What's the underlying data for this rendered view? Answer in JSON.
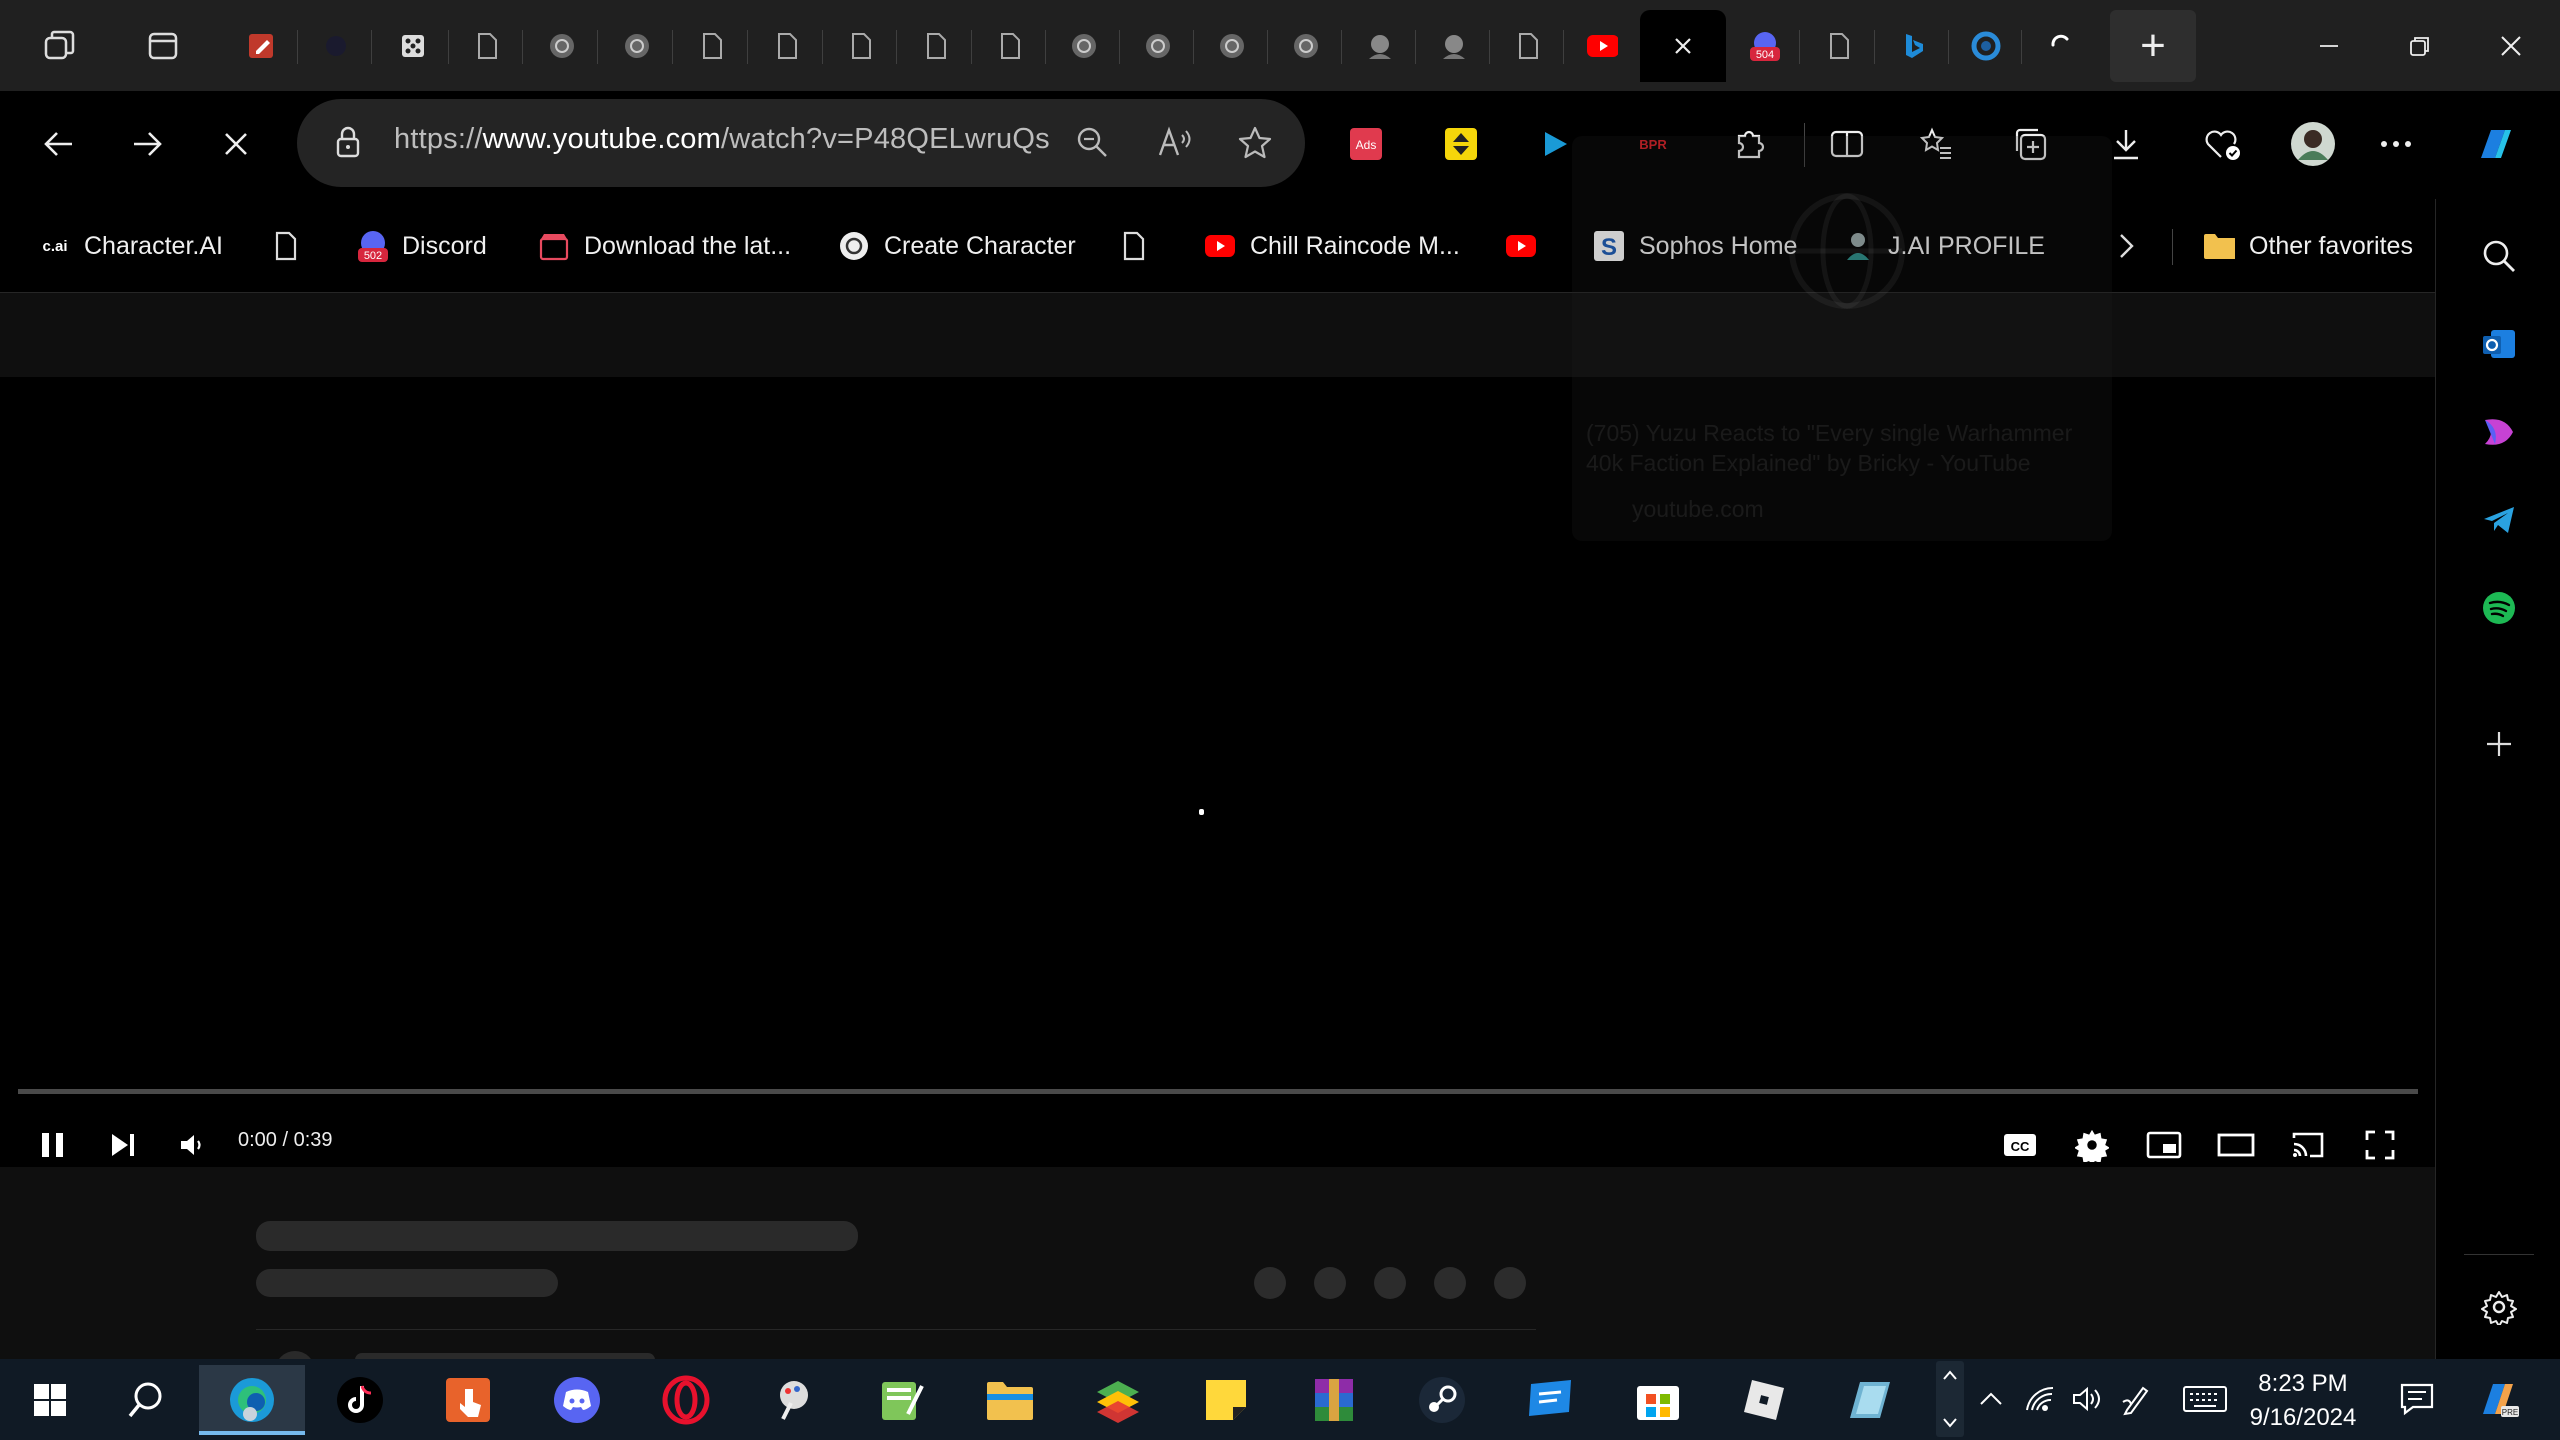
{
  "window": {
    "tab_count_visible": 28,
    "new_tab_label": "+",
    "controls": [
      "minimize",
      "restore",
      "close"
    ]
  },
  "toolbar": {
    "url_prefix": "https://",
    "url_host": "www.youtube.com",
    "url_path": "/watch?v=P48QELwruQs",
    "extensions": [
      {
        "name": "adobe-acrobat-icon",
        "label": "Ads"
      },
      {
        "name": "sort-extension-icon",
        "label": ""
      },
      {
        "name": "play-extension-icon",
        "label": ""
      },
      {
        "name": "bpr-extension-icon",
        "label": "BPR"
      }
    ]
  },
  "favorites": {
    "items": [
      {
        "label": "Character.AI",
        "icon_text": "c.ai"
      },
      {
        "label": ""
      },
      {
        "label": "Discord",
        "badge": "502"
      },
      {
        "label": "Download the lat..."
      },
      {
        "label": "Create Character"
      },
      {
        "label": ""
      },
      {
        "label": "Chill Raincode M..."
      },
      {
        "label": ""
      },
      {
        "label": "Sophos Home"
      },
      {
        "label": "J.AI PROFILE"
      },
      {
        "label": "Other favorites"
      }
    ]
  },
  "tab_preview": {
    "title": "(705) Yuzu Reacts to \"Every single Warhammer 40k Faction Explained\" by Bricky - YouTube",
    "domain": "youtube.com"
  },
  "player": {
    "time": "0:00 / 0:39",
    "progress": 0.0
  },
  "taskbar": {
    "time": "8:23 PM",
    "date": "9/16/2024"
  },
  "colors": {
    "tab_bg": "#202020",
    "youtube_red": "#ff0000",
    "taskbar_bg": "#101a25",
    "edge_accent": "#76b9ed"
  }
}
